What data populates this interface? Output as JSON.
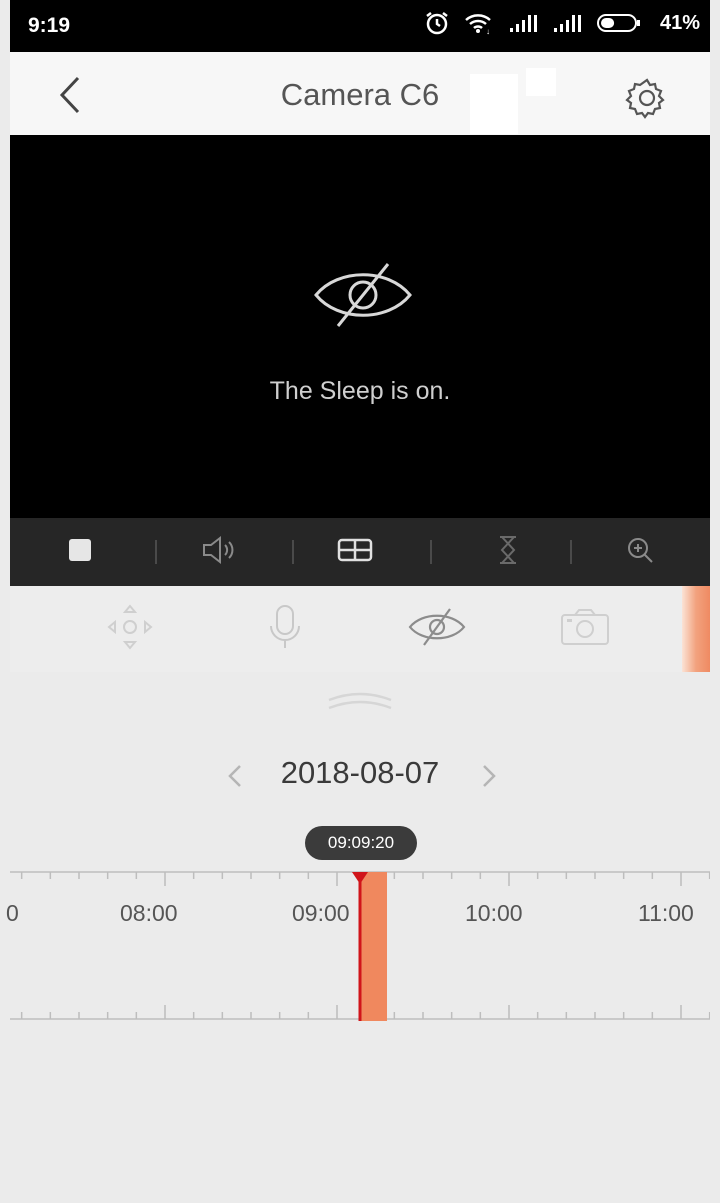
{
  "status_bar": {
    "time": "9:19",
    "battery": "41%",
    "battery_level": 0.41
  },
  "header": {
    "title": "Camera C6"
  },
  "video": {
    "message": "The Sleep is on."
  },
  "icons": {
    "back": "chevron-left-icon",
    "settings": "gear-icon",
    "sleep": "eye-slash-icon",
    "stop": "stop-icon",
    "volume": "speaker-icon",
    "split": "grid-icon",
    "clarity": "hourglass-icon",
    "zoom": "zoom-in-icon",
    "ptz": "ptz-direction-icon",
    "mic": "microphone-icon",
    "privacy": "eye-slash-icon",
    "snapshot": "camera-icon"
  },
  "playback": {
    "date": "2018-08-07",
    "current_time": "09:09:20",
    "hours": [
      "0",
      "08:00",
      "09:00",
      "10:00",
      "11:00"
    ]
  },
  "colors": {
    "accent": "#f0885e",
    "cursor": "#d0141a"
  }
}
